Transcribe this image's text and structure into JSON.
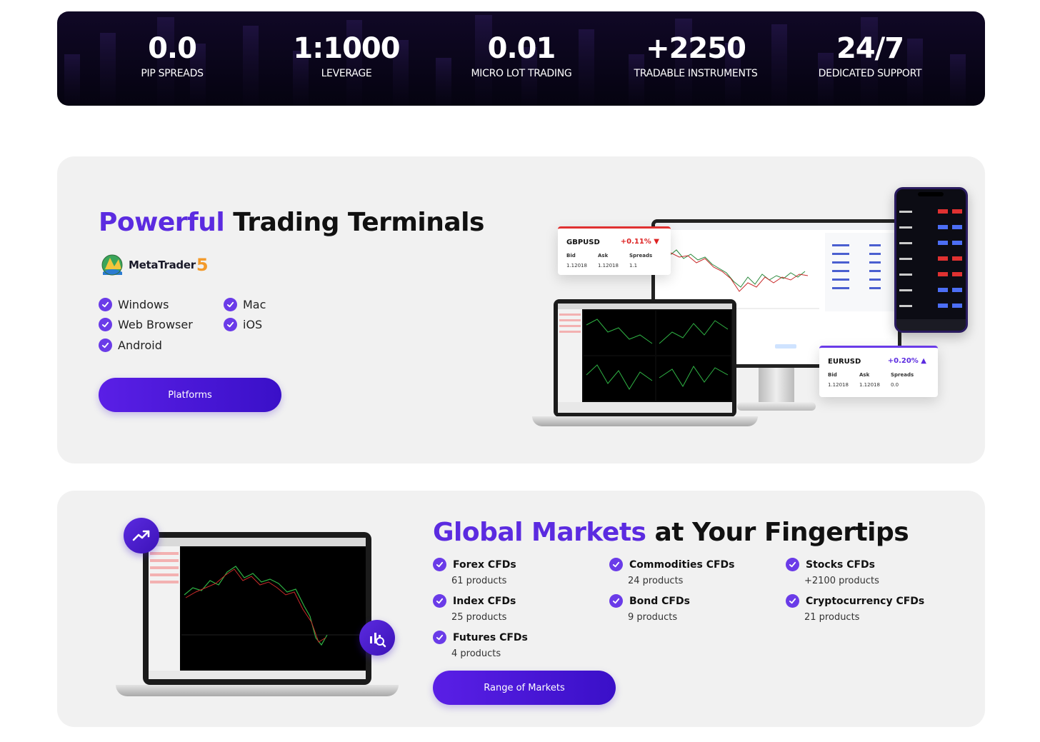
{
  "stats": [
    {
      "value": "0.0",
      "label": "PIP SPREADS"
    },
    {
      "value": "1:1000",
      "label": "LEVERAGE"
    },
    {
      "value": "0.01",
      "label": "MICRO LOT TRADING"
    },
    {
      "value": "+2250",
      "label": "TRADABLE INSTRUMENTS"
    },
    {
      "value": "24/7",
      "label": "DEDICATED SUPPORT"
    }
  ],
  "terminals": {
    "title_accent": "Powerful",
    "title_rest": "Trading Terminals",
    "logo_text": "MetaTrader",
    "logo_number": "5",
    "platforms": [
      "Windows",
      "Mac",
      "Web Browser",
      "iOS",
      "Android"
    ],
    "button": "Platforms",
    "quote_gbp": {
      "pair": "GBPUSD",
      "change": "+0.11% ▼",
      "bid_label": "Bid",
      "ask_label": "Ask",
      "spread_label": "Spreads",
      "bid": "1.12018",
      "ask": "1.12018",
      "spread": "1.1"
    },
    "quote_eur": {
      "pair": "EURUSD",
      "change": "+0.20% ▲",
      "bid_label": "Bid",
      "ask_label": "Ask",
      "spread_label": "Spreads",
      "bid": "1.12018",
      "ask": "1.12018",
      "spread": "0.0"
    }
  },
  "markets": {
    "title_accent": "Global Markets",
    "title_rest": "at Your Fingertips",
    "items": [
      {
        "name": "Forex CFDs",
        "count": "61 products"
      },
      {
        "name": "Commodities CFDs",
        "count": "24 products"
      },
      {
        "name": "Stocks CFDs",
        "count": "+2100 products"
      },
      {
        "name": "Index CFDs",
        "count": "25 products"
      },
      {
        "name": "Bond CFDs",
        "count": "9 products"
      },
      {
        "name": "Cryptocurrency CFDs",
        "count": "21 products"
      },
      {
        "name": "Futures CFDs",
        "count": "4 products"
      }
    ],
    "button": "Range of Markets"
  },
  "colors": {
    "accent": "#5b2be0",
    "button": "#4a17d8",
    "card_bg": "#f1f1f1",
    "stats_bg": "#0b0619",
    "down": "#d22222"
  }
}
